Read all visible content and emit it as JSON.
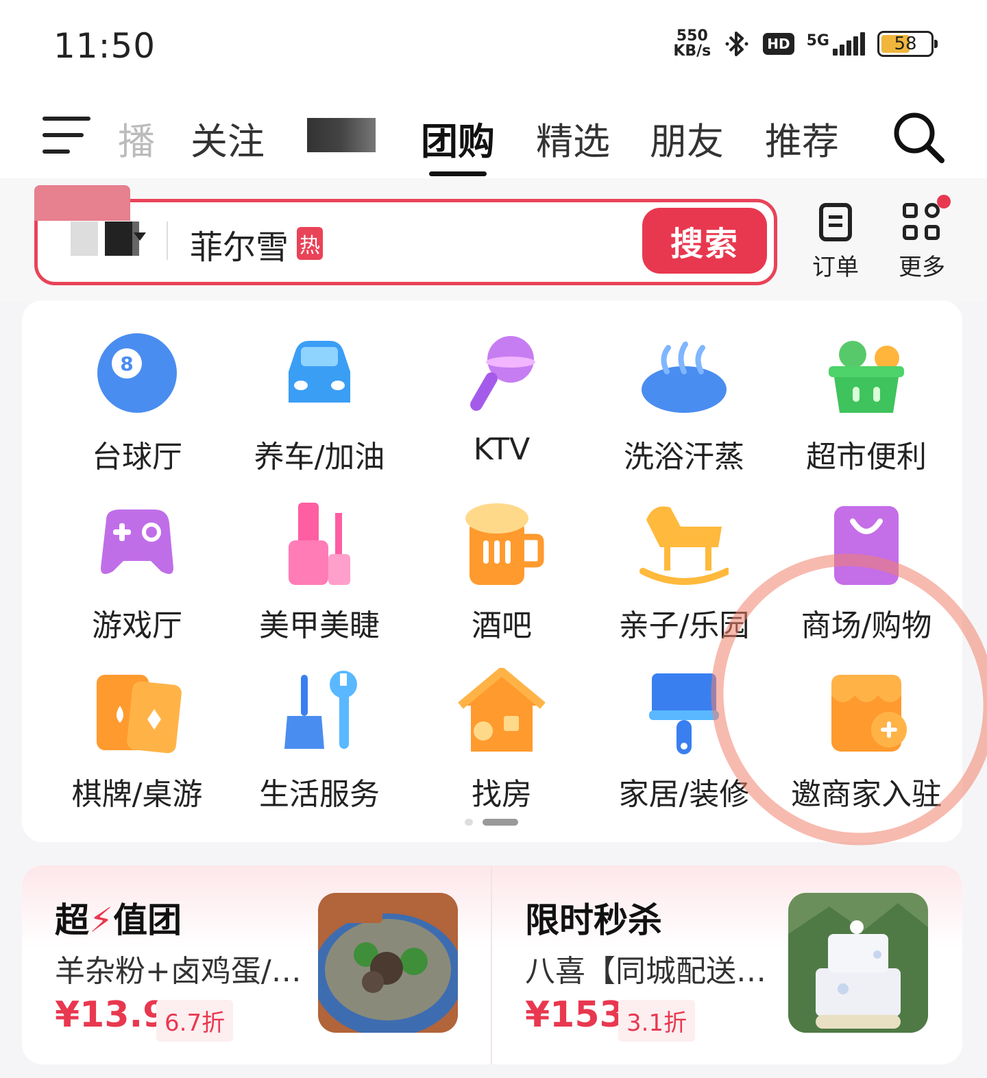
{
  "status_bar": {
    "time": "11:50",
    "net_speed_value": "550",
    "net_speed_unit": "KB/s",
    "hd": "HD",
    "network": "5G",
    "battery": "58",
    "battery_level": 0.58,
    "battery_color": "#f0b63c"
  },
  "nav": {
    "tabs": [
      {
        "label": "播"
      },
      {
        "label": "关注"
      },
      {
        "label": "团购"
      },
      {
        "label": "精选"
      },
      {
        "label": "朋友"
      },
      {
        "label": "推荐"
      }
    ],
    "active_tab": "团购"
  },
  "search": {
    "query": "菲尔雪",
    "hot_badge": "热",
    "button": "搜索",
    "accent": "#e8384f"
  },
  "quick_actions": [
    {
      "label": "订单",
      "icon": "order-icon"
    },
    {
      "label": "更多",
      "icon": "grid-more-icon"
    }
  ],
  "categories": [
    {
      "label": "台球厅",
      "icon": "billiard-ball-icon"
    },
    {
      "label": "养车/加油",
      "icon": "car-icon"
    },
    {
      "label": "KTV",
      "icon": "microphone-icon"
    },
    {
      "label": "洗浴汗蒸",
      "icon": "bath-steam-icon"
    },
    {
      "label": "超市便利",
      "icon": "grocery-basket-icon"
    },
    {
      "label": "游戏厅",
      "icon": "gamepad-icon"
    },
    {
      "label": "美甲美睫",
      "icon": "nail-polish-icon"
    },
    {
      "label": "酒吧",
      "icon": "beer-mug-icon"
    },
    {
      "label": "亲子/乐园",
      "icon": "rocking-horse-icon"
    },
    {
      "label": "商场/购物",
      "icon": "shopping-bag-icon"
    },
    {
      "label": "棋牌/桌游",
      "icon": "playing-cards-icon"
    },
    {
      "label": "生活服务",
      "icon": "broom-wrench-icon"
    },
    {
      "label": "找房",
      "icon": "house-icon"
    },
    {
      "label": "家居/装修",
      "icon": "paint-brush-icon"
    },
    {
      "label": "邀商家入驻",
      "icon": "store-add-icon"
    }
  ],
  "deals": [
    {
      "title_a": "超",
      "title_b": "值团",
      "desc": "羊杂粉+卤鸡蛋/…",
      "price": "¥13.9",
      "discount": "6.7折",
      "image": "lamb-noodle-soup-photo"
    },
    {
      "title_a": "限时秒",
      "title_b": "杀",
      "desc": "八喜【同城配送…",
      "price": "¥153",
      "discount": "3.1折",
      "image": "layered-cake-photo"
    }
  ]
}
